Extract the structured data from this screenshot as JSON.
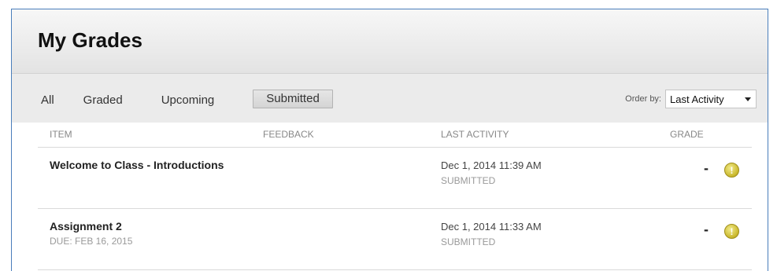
{
  "header": {
    "title": "My Grades"
  },
  "tabs": [
    {
      "label": "All"
    },
    {
      "label": "Graded"
    },
    {
      "label": "Upcoming"
    },
    {
      "label": "Submitted",
      "active": true
    }
  ],
  "order": {
    "label": "Order by:",
    "selected": "Last Activity"
  },
  "table": {
    "headers": {
      "item": "ITEM",
      "feedback": "FEEDBACK",
      "last_activity": "LAST ACTIVITY",
      "grade": "GRADE"
    },
    "rows": [
      {
        "title": "Welcome to Class - Introductions",
        "subtitle": "",
        "date": "Dec 1, 2014 11:39 AM",
        "status": "SUBMITTED",
        "grade": "-",
        "icon": "alert-icon"
      },
      {
        "title": "Assignment 2",
        "subtitle": "DUE: FEB 16, 2015",
        "date": "Dec 1, 2014 11:33 AM",
        "status": "SUBMITTED",
        "grade": "-",
        "icon": "alert-icon"
      }
    ]
  },
  "colors": {
    "frame_border": "#4a7ebb",
    "alert": "#c9b72c"
  }
}
